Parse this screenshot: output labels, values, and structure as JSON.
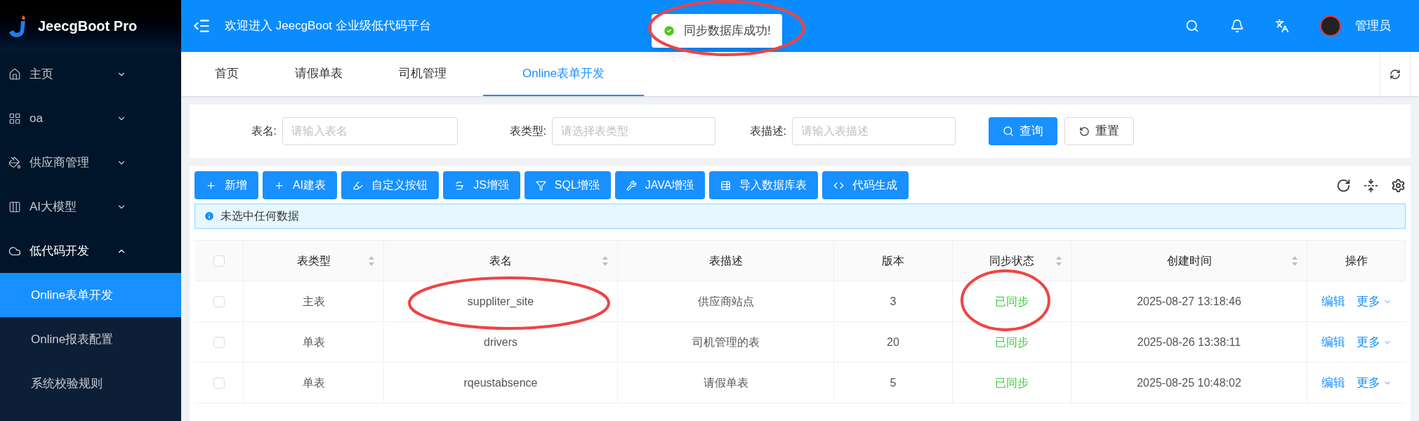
{
  "sidebar": {
    "logo": "JeecgBoot Pro",
    "items": [
      {
        "label": "主页",
        "expanded": false
      },
      {
        "label": "oa",
        "expanded": false
      },
      {
        "label": "供应商管理",
        "expanded": false
      },
      {
        "label": "AI大模型",
        "expanded": false
      },
      {
        "label": "低代码开发",
        "expanded": true,
        "children": [
          {
            "label": "Online表单开发",
            "selected": true
          },
          {
            "label": "Online报表配置",
            "selected": false
          },
          {
            "label": "系统校验规则",
            "selected": false
          }
        ]
      }
    ]
  },
  "header": {
    "title": "欢迎进入 JeecgBoot 企业级低代码平台",
    "user": "管理员"
  },
  "toast": {
    "message": "同步数据库成功!"
  },
  "tabs": [
    {
      "label": "首页",
      "selected": false
    },
    {
      "label": "请假单表",
      "selected": false
    },
    {
      "label": "司机管理",
      "selected": false
    },
    {
      "label": "Online表单开发",
      "selected": true
    }
  ],
  "search": {
    "fields": [
      {
        "label": "表名:",
        "placeholder": "请输入表名"
      },
      {
        "label": "表类型:",
        "placeholder": "请选择表类型"
      },
      {
        "label": "表描述:",
        "placeholder": "请输入表描述"
      }
    ],
    "query_button": "查询",
    "reset_button": "重置"
  },
  "toolbar": [
    "新增",
    "AI建表",
    "自定义按钮",
    "JS增强",
    "SQL增强",
    "JAVA增强",
    "导入数据库表",
    "代码生成"
  ],
  "alert": "未选中任何数据",
  "table": {
    "select_all_checked": false,
    "columns": [
      {
        "label": "表类型",
        "sortable": true
      },
      {
        "label": "表名",
        "sortable": true
      },
      {
        "label": "表描述",
        "sortable": false
      },
      {
        "label": "版本",
        "sortable": false
      },
      {
        "label": "同步状态",
        "sortable": true
      },
      {
        "label": "创建时间",
        "sortable": true
      },
      {
        "label": "操作",
        "sortable": false
      }
    ],
    "rows": [
      {
        "checked": false,
        "type": "主表",
        "name": "suppliter_site",
        "description": "供应商站点",
        "version": "3",
        "sync": "已同步",
        "created": "2025-08-27 13:18:46",
        "edit": "编辑",
        "more": "更多"
      },
      {
        "checked": false,
        "type": "单表",
        "name": "drivers",
        "description": "司机管理的表",
        "version": "20",
        "sync": "已同步",
        "created": "2025-08-26 13:38:11",
        "edit": "编辑",
        "more": "更多"
      },
      {
        "checked": false,
        "type": "单表",
        "name": "rqeustabsence",
        "description": "请假单表",
        "version": "5",
        "sync": "已同步",
        "created": "2025-08-25 10:48:02",
        "edit": "编辑",
        "more": "更多"
      }
    ]
  }
}
